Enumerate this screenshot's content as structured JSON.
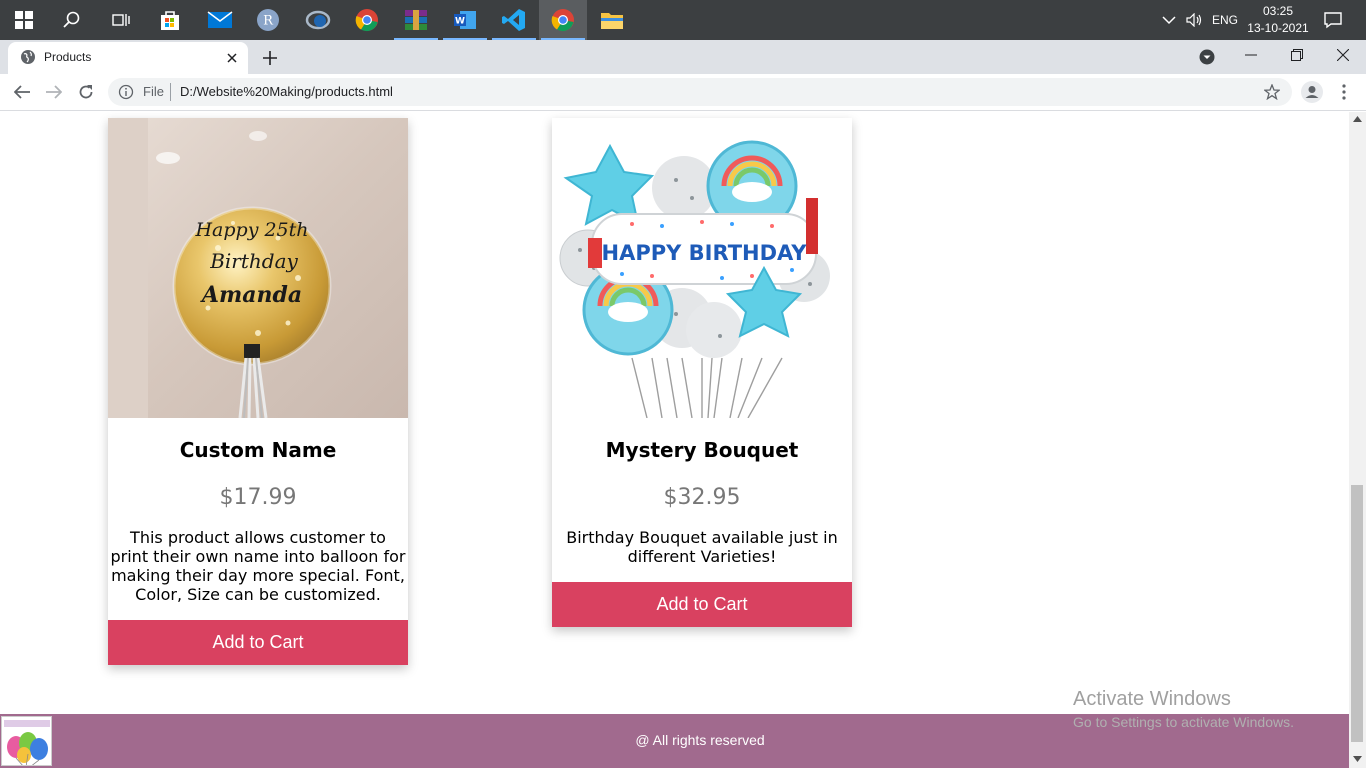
{
  "taskbar": {
    "apps": [
      {
        "name": "start-icon"
      },
      {
        "name": "search-icon"
      },
      {
        "name": "task-view-icon"
      },
      {
        "name": "store-icon"
      },
      {
        "name": "mail-icon"
      },
      {
        "name": "r-icon",
        "letter": "R"
      },
      {
        "name": "rstudio-icon"
      },
      {
        "name": "chrome-icon"
      },
      {
        "name": "winrar-icon"
      },
      {
        "name": "word-icon",
        "letter": "W"
      },
      {
        "name": "vscode-icon"
      },
      {
        "name": "chrome-active-icon"
      },
      {
        "name": "file-explorer-icon"
      }
    ],
    "language": "ENG",
    "time": "03:25",
    "date": "13-10-2021"
  },
  "browser": {
    "tab_title": "Products",
    "omnibox_scheme": "File",
    "url": "D:/Website%20Making/products.html"
  },
  "products": [
    {
      "name": "Custom Name",
      "price": "$17.99",
      "description": "This product allows customer to print their own name into balloon for making their day more special. Font, Color, Size can be customized.",
      "button": "Add to Cart",
      "image_text": [
        "Happy 25th",
        "Birthday",
        "Amanda"
      ]
    },
    {
      "name": "Mystery Bouquet",
      "price": "$32.95",
      "description": "Birthday Bouquet available just in different Varieties!",
      "button": "Add to Cart",
      "image_text": "HAPPY BIRTHDAY"
    }
  ],
  "watermark": {
    "line1": "Activate Windows",
    "line2": "Go to Settings to activate Windows."
  },
  "footer": {
    "text": "@ All rights reserved"
  },
  "colors": {
    "button": "#d94160",
    "footer": "#a16a8e",
    "taskbar": "#3c3f41"
  }
}
